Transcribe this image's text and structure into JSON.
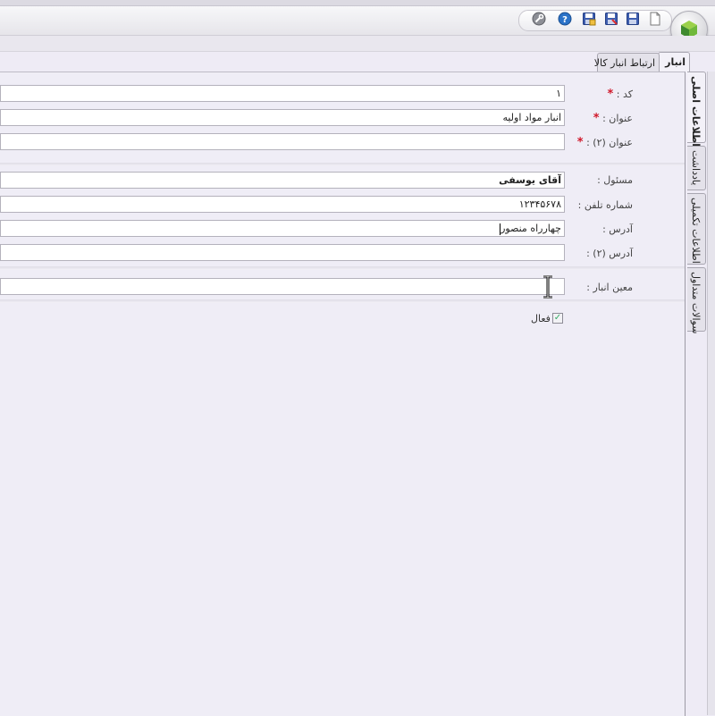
{
  "toolbar": {
    "icons": [
      "new-document-icon",
      "save-icon",
      "save-as-icon",
      "save-close-icon",
      "help-icon",
      "tools-icon"
    ]
  },
  "tabs": [
    {
      "label": "انبار",
      "active": true
    },
    {
      "label": "ارتباط انبار کالا",
      "active": false
    }
  ],
  "side_tabs": [
    {
      "label": "اطلاعات اصلی",
      "active": true
    },
    {
      "label": "یادداشت",
      "active": false
    },
    {
      "label": "اطلاعات تکمیلی",
      "active": false
    },
    {
      "label": "سوالات متداول",
      "active": false
    }
  ],
  "form": {
    "code": {
      "label": "کد :",
      "value": "۱",
      "required": "*"
    },
    "title": {
      "label": "عنوان :",
      "value": "انبار مواد اولیه",
      "required": "*"
    },
    "title2": {
      "label": "عنوان (۲) :",
      "value": "",
      "required": "*"
    },
    "manager": {
      "label": "مسئول :",
      "value": "آقای یوسفی"
    },
    "phone": {
      "label": "شماره تلفن :",
      "value": "۱۲۳۴۵۶۷۸"
    },
    "address": {
      "label": "آدرس :",
      "value": "چهارراه منصور"
    },
    "address2": {
      "label": "آدرس (۲) :",
      "value": ""
    },
    "warehouse_keeper": {
      "label": "معین انبار :",
      "value": ""
    },
    "active": {
      "label": "فعال",
      "checked": true
    }
  }
}
